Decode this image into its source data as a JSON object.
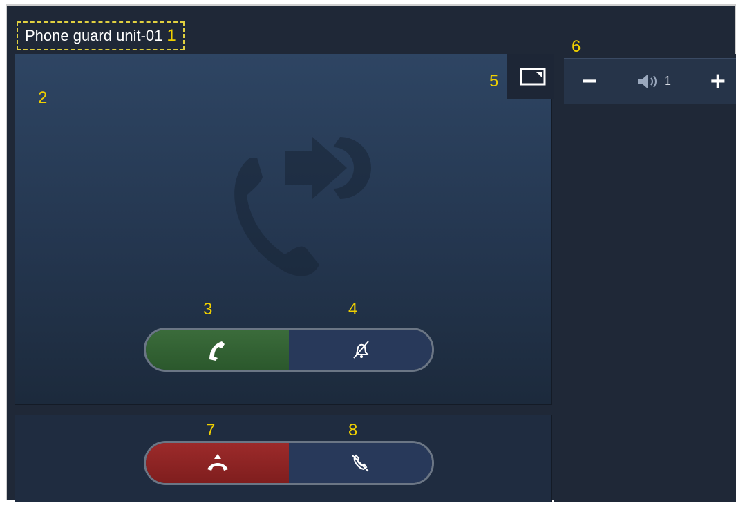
{
  "header": {
    "title": "Phone guard unit-01"
  },
  "markers": {
    "m1": "1",
    "m2": "2",
    "m3": "3",
    "m4": "4",
    "m5": "5",
    "m6": "6",
    "m7": "7",
    "m8": "8"
  },
  "volume": {
    "minus_label": "−",
    "plus_label": "+",
    "level": "1"
  },
  "icons": {
    "pip": "picture-in-picture-icon",
    "background": "call-forward-icon",
    "accept": "phone-handset-icon",
    "mute_ringtone": "bell-off-icon",
    "hangup": "hang-up-icon",
    "mic_mute": "microphone-off-icon",
    "speaker": "speaker-icon"
  },
  "colors": {
    "accept": "#2f5e30",
    "hangup": "#8c2222",
    "marker": "#f0d000"
  }
}
